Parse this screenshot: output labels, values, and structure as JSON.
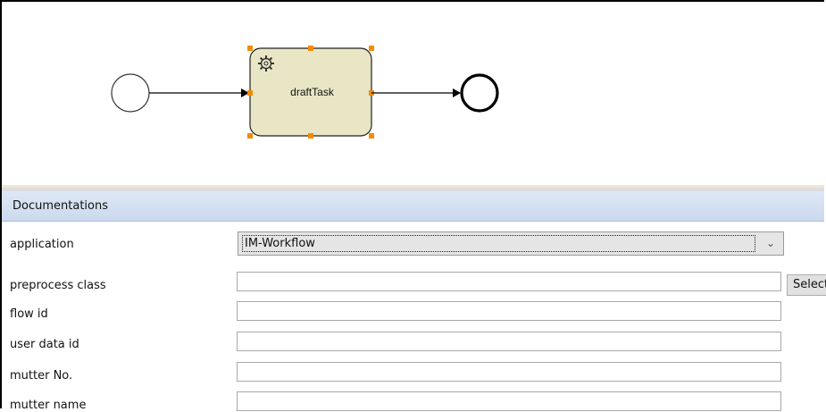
{
  "diagram": {
    "task_name": "draftTask",
    "icons": {
      "start_event": "start-event-circle",
      "end_event": "end-event-circle",
      "task_icon": "gear-icon"
    },
    "colors": {
      "task_fill": "#e8e6c5",
      "selection_handle": "#f28c00"
    }
  },
  "section": {
    "title": "Documentations"
  },
  "form": {
    "application": {
      "label": "application",
      "value": "IM-Workflow"
    },
    "preprocess_class": {
      "label": "preprocess class",
      "value": "",
      "button_label": "Select"
    },
    "flow_id": {
      "label": "flow id",
      "value": ""
    },
    "user_data_id": {
      "label": "user data id",
      "value": ""
    },
    "mutter_no": {
      "label": "mutter No.",
      "value": ""
    },
    "mutter_name": {
      "label": "mutter name",
      "value": ""
    }
  }
}
